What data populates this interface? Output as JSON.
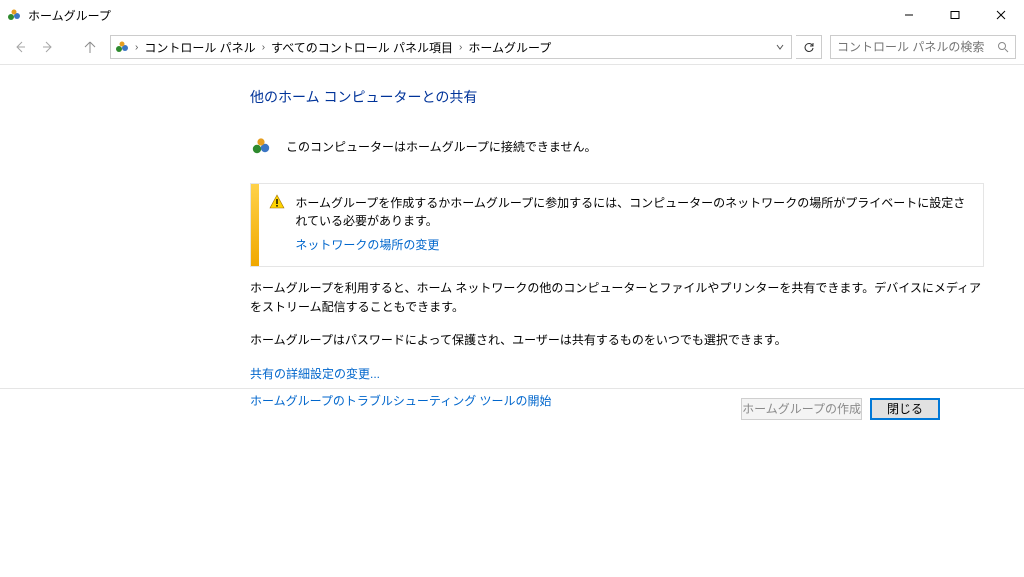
{
  "window": {
    "title": "ホームグループ"
  },
  "breadcrumb": {
    "items": [
      "コントロール パネル",
      "すべてのコントロール パネル項目",
      "ホームグループ"
    ]
  },
  "search": {
    "placeholder": "コントロール パネルの検索"
  },
  "main": {
    "heading": "他のホーム コンピューターとの共有",
    "status": "このコンピューターはホームグループに接続できません。",
    "warning": {
      "text": "ホームグループを作成するかホームグループに参加するには、コンピューターのネットワークの場所がプライベートに設定されている必要があります。",
      "link": "ネットワークの場所の変更"
    },
    "paragraph1": "ホームグループを利用すると、ホーム ネットワークの他のコンピューターとファイルやプリンターを共有できます。デバイスにメディアをストリーム配信することもできます。",
    "paragraph2": "ホームグループはパスワードによって保護され、ユーザーは共有するものをいつでも選択できます。",
    "link_advanced": "共有の詳細設定の変更...",
    "link_troubleshoot": "ホームグループのトラブルシューティング ツールの開始"
  },
  "buttons": {
    "create": "ホームグループの作成",
    "close": "閉じる"
  }
}
